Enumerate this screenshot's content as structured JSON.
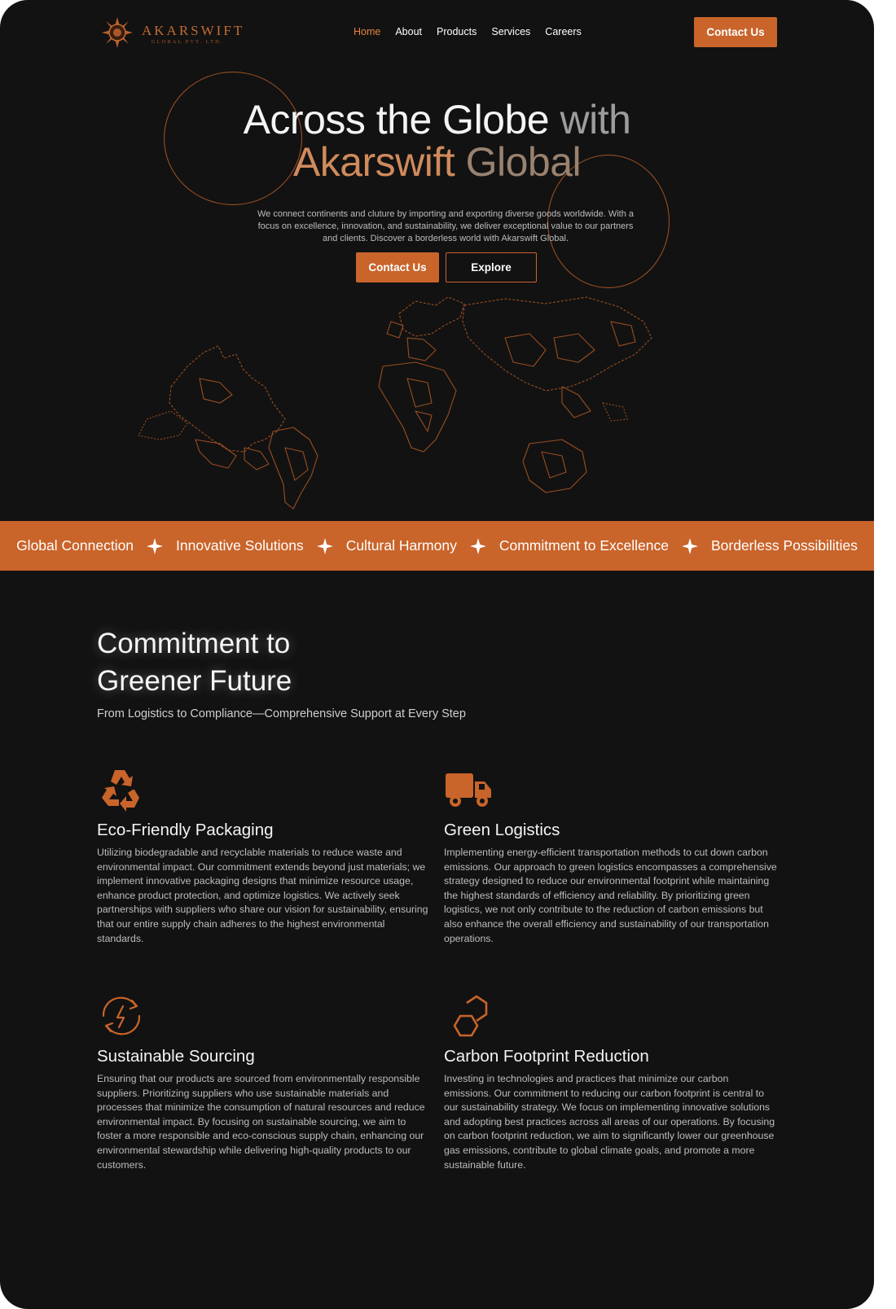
{
  "brand": {
    "name": "AKARSWIFT",
    "subtitle": "GLOBAL PVT. LTD.",
    "logo_icon": "sun-emblem-icon"
  },
  "nav": {
    "items": [
      {
        "label": "Home",
        "active": true
      },
      {
        "label": "About"
      },
      {
        "label": "Products"
      },
      {
        "label": "Services"
      },
      {
        "label": "Careers"
      }
    ],
    "cta_label": "Contact Us"
  },
  "hero": {
    "title_line1_a": "Across the Globe ",
    "title_line1_b": "with",
    "title_line2_a": "Akarswift ",
    "title_line2_b": "Global",
    "description": "We connect continents and cluture by importing and exporting diverse goods worldwide. With a focus on excellence, innovation, and sustainability, we deliver exceptional value to our partners and clients. Discover a borderless world with Akarswift Global.",
    "contact_label": "Contact Us",
    "explore_label": "Explore",
    "map_icon": "world-map-illustration"
  },
  "marquee": {
    "items": [
      "Global Connection",
      "Innovative Solutions",
      "Cultural Harmony",
      "Commitment to Excellence",
      "Borderless Possibilities"
    ],
    "separator_icon": "four-point-star-icon"
  },
  "commitment": {
    "title_line1": "Commitment to",
    "title_line2": "Greener Future",
    "subtitle": "From Logistics to Compliance—Comprehensive Support at Every Step",
    "features": [
      {
        "icon": "recycle-icon",
        "title": "Eco-Friendly Packaging",
        "text": "Utilizing biodegradable and recyclable materials to reduce waste and environmental impact. Our commitment extends beyond just materials; we implement innovative packaging designs that minimize resource usage, enhance product protection, and optimize logistics. We actively seek partnerships with suppliers who share our vision for sustainability, ensuring that our entire supply chain adheres to the highest environmental standards."
      },
      {
        "icon": "truck-icon",
        "title": "Green Logistics",
        "text": "Implementing energy-efficient transportation methods to cut down carbon emissions. Our approach to green logistics encompasses a comprehensive strategy designed to reduce our environmental footprint while maintaining the highest standards of efficiency and reliability. By prioritizing green logistics, we not only contribute to the reduction of carbon emissions but also enhance the overall efficiency and sustainability of our transportation operations."
      },
      {
        "icon": "renewable-energy-icon",
        "title": "Sustainable Sourcing",
        "text": "Ensuring that our products are sourced from environmentally responsible suppliers. Prioritizing suppliers who use sustainable materials and processes that minimize the consumption of natural resources and reduce environmental impact. By focusing on sustainable sourcing, we aim to foster a more responsible and eco-conscious supply chain, enhancing our environmental stewardship while delivering high-quality products to our customers."
      },
      {
        "icon": "hexagon-icon",
        "title": "Carbon Footprint Reduction",
        "text": "Investing in technologies and practices that minimize our carbon emissions. Our commitment to reducing our carbon footprint is central to our sustainability strategy. We focus on implementing innovative solutions and adopting best practices across all areas of our operations. By focusing on carbon footprint reduction, we aim to significantly lower our greenhouse gas emissions, contribute to global climate goals, and promote a more sustainable future."
      }
    ]
  },
  "colors": {
    "accent": "#c9642a",
    "background": "#121212",
    "text": "#f4f4f4"
  }
}
